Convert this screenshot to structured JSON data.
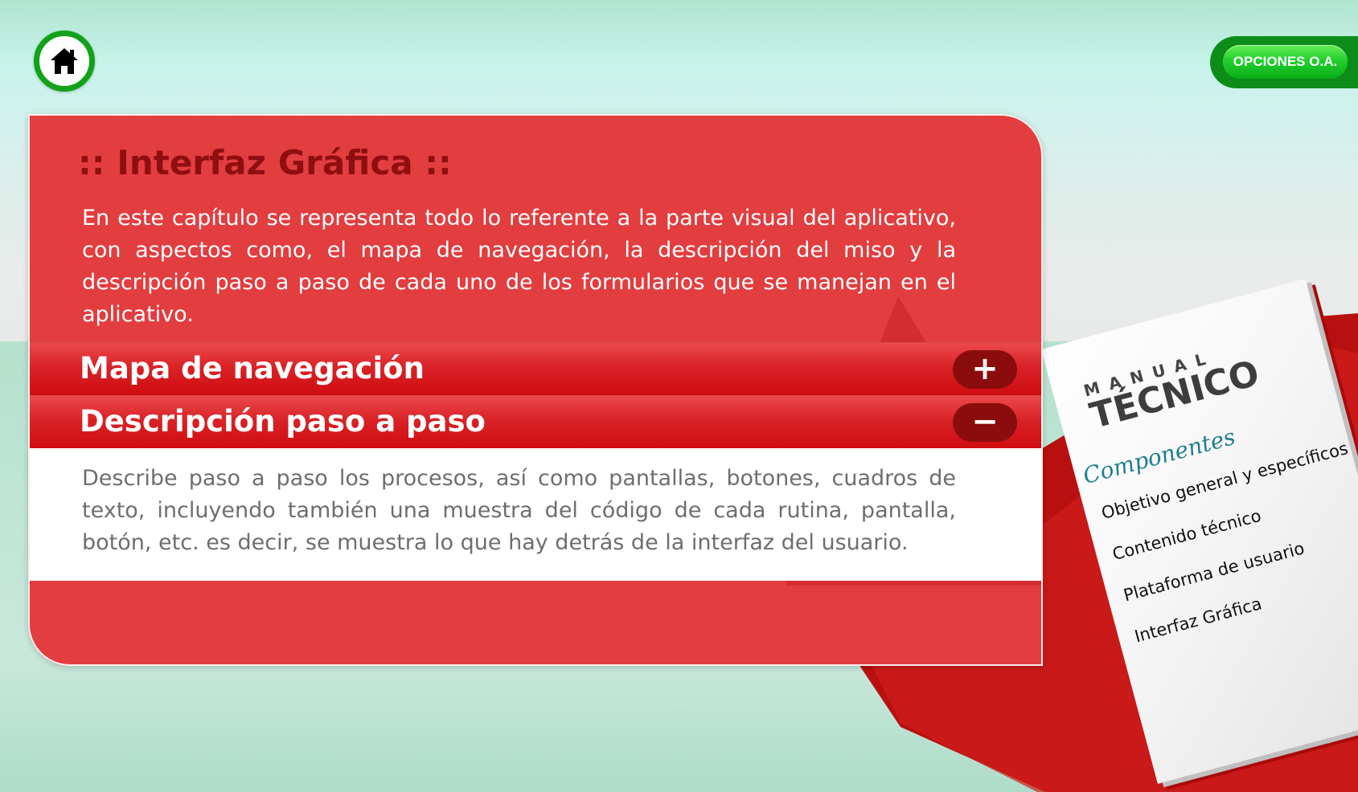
{
  "nav": {
    "home_icon": "home-icon",
    "options_label": "OPCIONES O.A."
  },
  "panel": {
    "title": ":: Interfaz Gráfica ::",
    "intro": "En este capítulo se representa todo lo referente a la parte visual del aplicativo, con aspectos como, el mapa de navegación, la descripción del miso y la descripción paso a paso de cada uno de los formularios que se manejan en el aplicativo.",
    "sections": [
      {
        "label": "Mapa de navegación",
        "toggle": "+",
        "expanded": false
      },
      {
        "label": "Descripción paso a paso",
        "toggle": "−",
        "expanded": true,
        "body": "Describe paso a paso los procesos, así como pantallas, botones, cuadros de texto, incluyendo también una muestra del código de cada rutina, pantalla, botón, etc. es decir, se muestra lo que hay detrás de la interfaz del usuario."
      }
    ]
  },
  "manual": {
    "title_small": "MANUAL",
    "title_big": "TÉCNICO",
    "components_label": "Componentes",
    "items": [
      "Objetivo general y específicos",
      "Contenido técnico",
      "Plataforma de usuario",
      "Interfaz Gráfica"
    ]
  },
  "colors": {
    "panel_red": "#e23d3f",
    "header_red": "#d92327",
    "title_dark_red": "#8f0f11",
    "green": "#12a21a"
  }
}
